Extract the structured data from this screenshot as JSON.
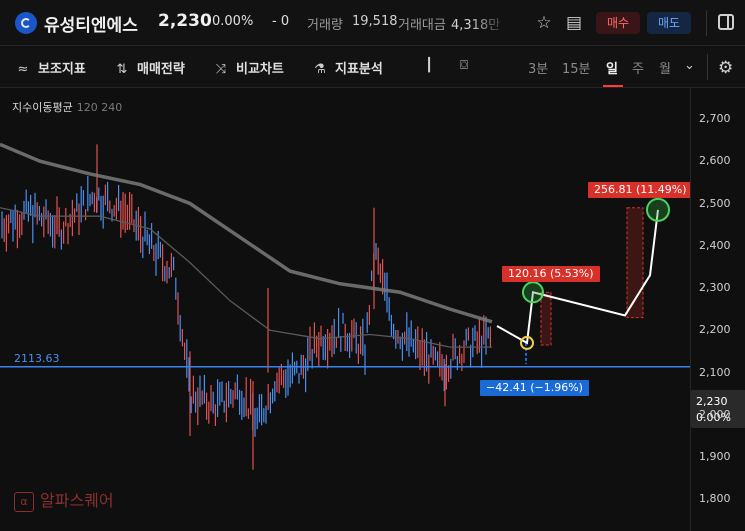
{
  "header": {
    "stock_name": "유성티엔에스",
    "price": "2,230",
    "change_pct": "0.00%",
    "change_abs": "- 0",
    "volume_label": "거래량",
    "volume_value": "19,518",
    "amount_label": "거래대금",
    "amount_value": "4,318만",
    "buy_label": "매수",
    "sell_label": "매도",
    "icons": [
      "star-icon",
      "clipboard-icon",
      "panel-layout-icon"
    ]
  },
  "toolbar": {
    "tools": [
      {
        "label": "보조지표",
        "icon": "indicator-icon"
      },
      {
        "label": "매매전략",
        "icon": "strategy-icon"
      },
      {
        "label": "비교차트",
        "icon": "compare-icon"
      },
      {
        "label": "지표분석",
        "icon": "analysis-icon"
      }
    ],
    "extra_icons": [
      "candlestick-icon",
      "camera-icon"
    ],
    "timeframes": [
      "3분",
      "15분",
      "일",
      "주",
      "월"
    ],
    "active_timeframe": "일",
    "dropdown_icon": "chevron-down-icon",
    "settings_icon": "gear-icon"
  },
  "chart": {
    "indicator_title": "지수이동평균",
    "indicator_params": "120 240",
    "y_ticks": [
      "2,700",
      "2,600",
      "2,500",
      "2,400",
      "2,300",
      "2,200",
      "2,100",
      "2,000",
      "1,900",
      "1,800"
    ],
    "y_tick_values": [
      2700,
      2600,
      2500,
      2400,
      2300,
      2200,
      2100,
      2000,
      1900,
      1800
    ],
    "current_price_label": "2,230",
    "current_change_label": "0.00%",
    "horizontal_line_label": "2113.63",
    "horizontal_line_value": 2113.63,
    "annotations": [
      {
        "text": "256.81  (11.49%)",
        "color": "#d8312a"
      },
      {
        "text": "120.16  (5.53%)",
        "color": "#d8312a"
      },
      {
        "text": "−42.41  (−1.96%)",
        "color": "#1a6bd6"
      }
    ],
    "watermark": "알파스퀘어",
    "up_color": "#e05252",
    "down_color": "#4a8ff0"
  }
}
